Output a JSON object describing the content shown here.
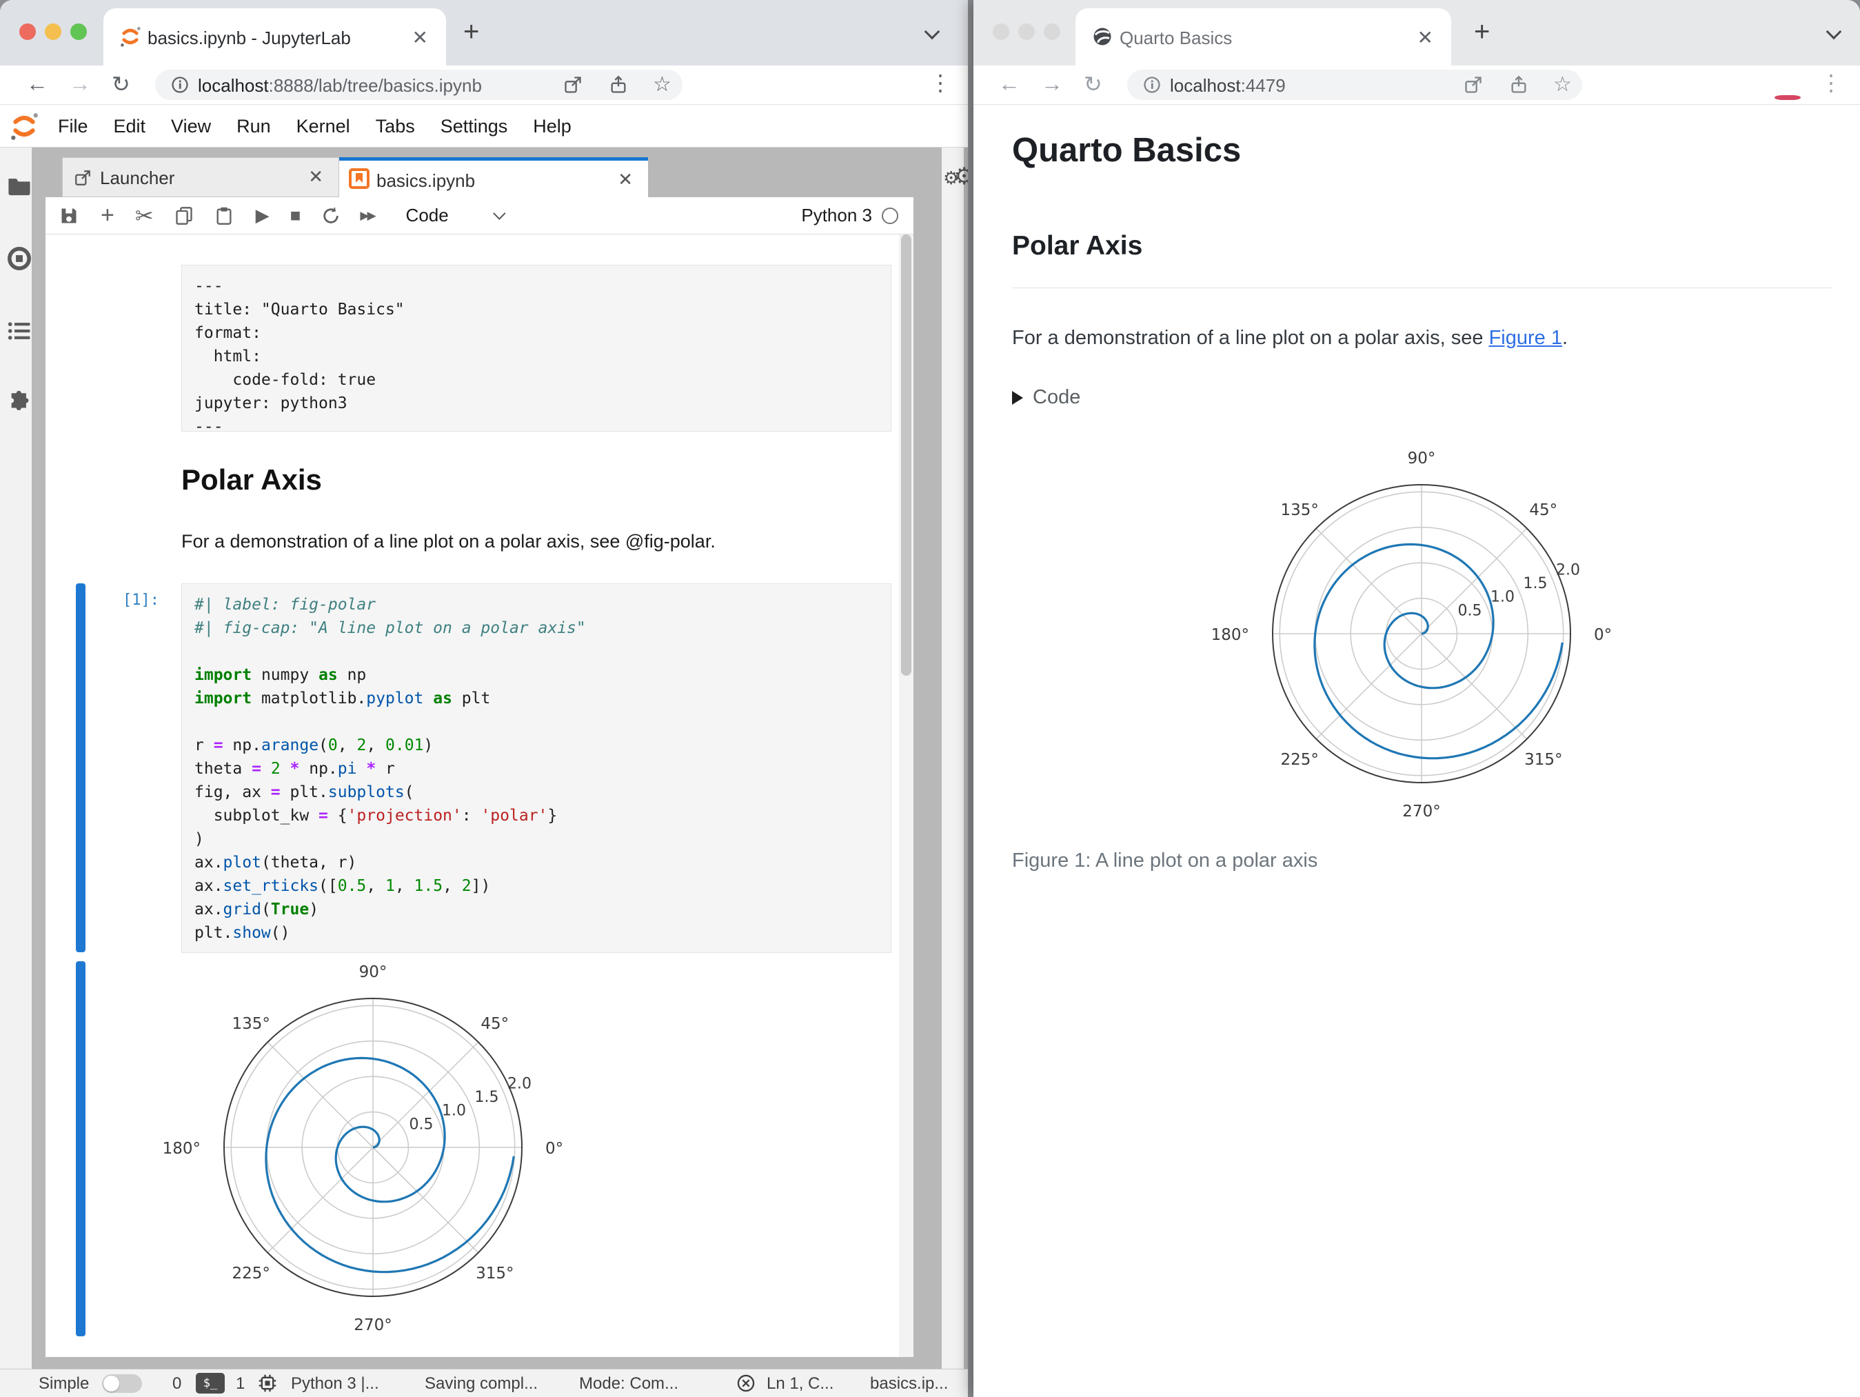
{
  "colors": {
    "accent_blue": "#1976d2",
    "jupyter_orange": "#f37626",
    "link_blue": "#2f6fe4",
    "plot_line": "#1f77b4"
  },
  "left_window": {
    "browser": {
      "tab_title": "basics.ipynb - JupyterLab",
      "close_glyph": "✕",
      "new_tab_glyph": "+",
      "url_host": "localhost",
      "url_rest": ":8888/lab/tree/basics.ipynb",
      "menu_dots": "⋮"
    },
    "menubar": [
      "File",
      "Edit",
      "View",
      "Run",
      "Kernel",
      "Tabs",
      "Settings",
      "Help"
    ],
    "dock_tabs": {
      "launcher": "Launcher",
      "notebook": "basics.ipynb",
      "close_glyph": "✕"
    },
    "toolbar": {
      "cell_type": "Code",
      "kernel_name": "Python 3"
    },
    "notebook": {
      "yaml_cell": {
        "lines": [
          "---",
          "title: \"Quarto Basics\"",
          "format:",
          "  html:",
          "    code-fold: true",
          "jupyter: python3",
          "---"
        ]
      },
      "heading": "Polar Axis",
      "paragraph": "For a demonstration of a line plot on a polar axis, see @fig-polar.",
      "code_cell": {
        "prompt": "[1]:",
        "lines": [
          [
            [
              "cm",
              "#| label: fig-polar"
            ]
          ],
          [
            [
              "cm",
              "#| fig-cap: \"A line plot on a polar axis\""
            ]
          ],
          [],
          [
            [
              "kw",
              "import"
            ],
            [
              "txt",
              " numpy "
            ],
            [
              "kw",
              "as"
            ],
            [
              "txt",
              " np"
            ]
          ],
          [
            [
              "kw",
              "import"
            ],
            [
              "txt",
              " matplotlib."
            ],
            [
              "fn",
              "pyplot"
            ],
            [
              "txt",
              " "
            ],
            [
              "kw",
              "as"
            ],
            [
              "txt",
              " plt"
            ]
          ],
          [],
          [
            [
              "txt",
              "r "
            ],
            [
              "op",
              "="
            ],
            [
              "txt",
              " np."
            ],
            [
              "fn",
              "arange"
            ],
            [
              "txt",
              "("
            ],
            [
              "num",
              "0"
            ],
            [
              "txt",
              ", "
            ],
            [
              "num",
              "2"
            ],
            [
              "txt",
              ", "
            ],
            [
              "num",
              "0.01"
            ],
            [
              "txt",
              ")"
            ]
          ],
          [
            [
              "txt",
              "theta "
            ],
            [
              "op",
              "="
            ],
            [
              "txt",
              " "
            ],
            [
              "num",
              "2"
            ],
            [
              "txt",
              " "
            ],
            [
              "op",
              "*"
            ],
            [
              "txt",
              " np."
            ],
            [
              "fn",
              "pi"
            ],
            [
              "txt",
              " "
            ],
            [
              "op",
              "*"
            ],
            [
              "txt",
              " r"
            ]
          ],
          [
            [
              "txt",
              "fig, ax "
            ],
            [
              "op",
              "="
            ],
            [
              "txt",
              " plt."
            ],
            [
              "fn",
              "subplots"
            ],
            [
              "txt",
              "("
            ]
          ],
          [
            [
              "txt",
              "  subplot_kw "
            ],
            [
              "op",
              "="
            ],
            [
              "txt",
              " {"
            ],
            [
              "str",
              "'projection'"
            ],
            [
              "txt",
              ": "
            ],
            [
              "str",
              "'polar'"
            ],
            [
              "txt",
              "}"
            ]
          ],
          [
            [
              "txt",
              ")"
            ]
          ],
          [
            [
              "txt",
              "ax."
            ],
            [
              "fn",
              "plot"
            ],
            [
              "txt",
              "(theta, r)"
            ]
          ],
          [
            [
              "txt",
              "ax."
            ],
            [
              "fn",
              "set_rticks"
            ],
            [
              "txt",
              "(["
            ],
            [
              "num",
              "0.5"
            ],
            [
              "txt",
              ", "
            ],
            [
              "num",
              "1"
            ],
            [
              "txt",
              ", "
            ],
            [
              "num",
              "1.5"
            ],
            [
              "txt",
              ", "
            ],
            [
              "num",
              "2"
            ],
            [
              "txt",
              "])"
            ]
          ],
          [
            [
              "txt",
              "ax."
            ],
            [
              "fn",
              "grid"
            ],
            [
              "txt",
              "("
            ],
            [
              "kw",
              "True"
            ],
            [
              "txt",
              ")"
            ]
          ],
          [
            [
              "txt",
              "plt."
            ],
            [
              "fn",
              "show"
            ],
            [
              "txt",
              "()"
            ]
          ]
        ]
      }
    },
    "statusbar": {
      "mode_toggle_label": "Simple",
      "terminals_count": "0",
      "terminal_badge": "$_",
      "kernels_count": "1",
      "kernel_status": "Python 3 |...",
      "saving_status": "Saving compl...",
      "mode": "Mode: Com...",
      "cursor_position": "Ln 1, C...",
      "filename": "basics.ip..."
    }
  },
  "right_window": {
    "browser": {
      "tab_title": "Quarto Basics",
      "close_glyph": "✕",
      "new_tab_glyph": "+",
      "url_host": "localhost",
      "url_rest": ":4479",
      "menu_dots": "⋮"
    },
    "page": {
      "title": "Quarto Basics",
      "section_heading": "Polar Axis",
      "paragraph_prefix": "For a demonstration of a line plot on a polar axis, see ",
      "link_text": "Figure 1",
      "paragraph_suffix": ".",
      "code_fold_label": "Code",
      "figure_caption": "Figure 1: A line plot on a polar axis"
    }
  },
  "chart_data": {
    "type": "line",
    "projection": "polar",
    "description": "Archimedean spiral: r = np.arange(0, 2, 0.01), theta = 2 * pi * r",
    "r_start": 0,
    "r_stop": 2,
    "r_step": 0.01,
    "theta_formula": "theta = 2 * pi * r",
    "angular_ticks_deg": [
      0,
      45,
      90,
      135,
      180,
      225,
      270,
      315
    ],
    "angular_tick_labels": [
      "0°",
      "45°",
      "90°",
      "135°",
      "180°",
      "225°",
      "270°",
      "315°"
    ],
    "radial_ticks": [
      0.5,
      1.0,
      1.5,
      2.0
    ],
    "radial_tick_labels": [
      "0.5",
      "1.0",
      "1.5",
      "2.0"
    ],
    "rlabel_angle_deg": 22.5,
    "r_axis_max": 2.1,
    "grid": true,
    "line_color": "#1f77b4",
    "grid_color": "#cccccc",
    "spine_color": "#3d3d3d",
    "tick_text_color": "#3c3c3c"
  }
}
